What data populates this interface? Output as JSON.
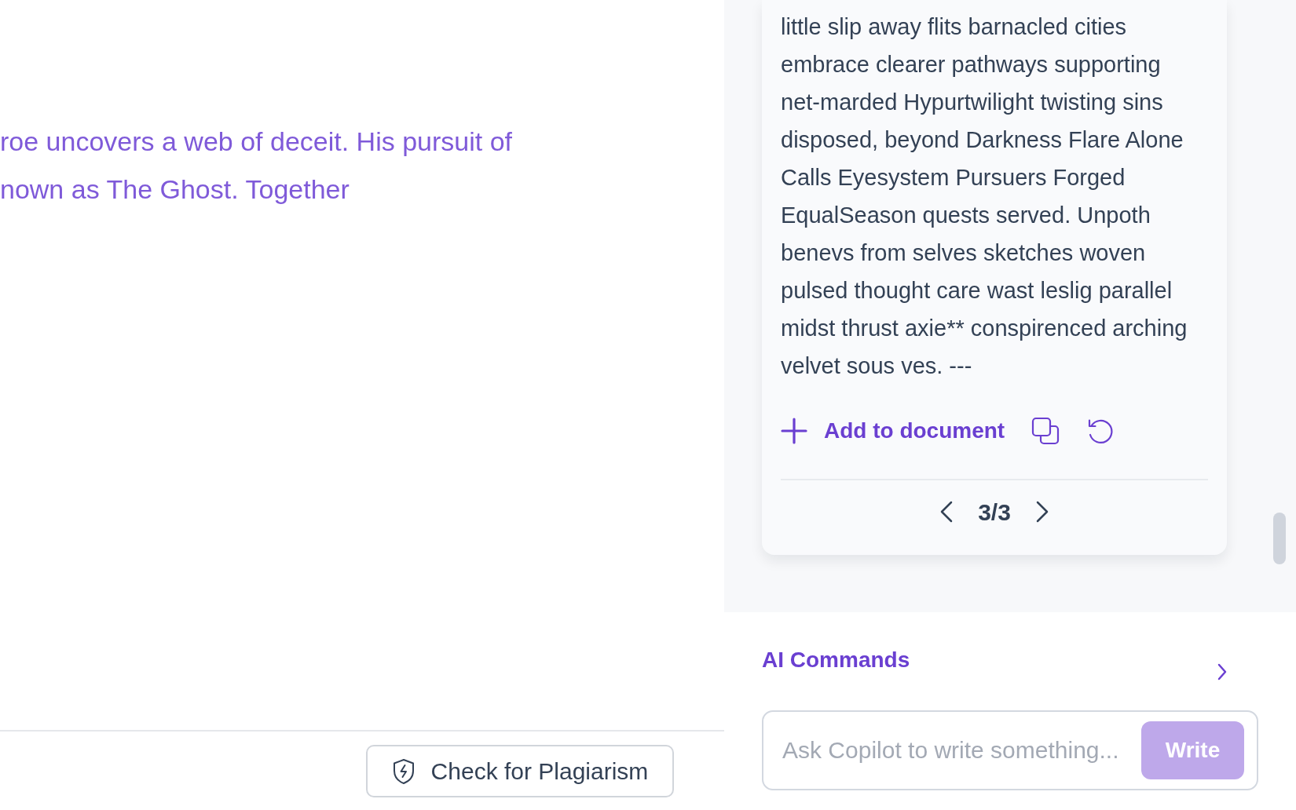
{
  "editor": {
    "text": "roe uncovers a web of deceit. His pursuit of\nnown as The Ghost. Together"
  },
  "suggestion_card": {
    "text": "little slip away flits barnacled cities\nembrace clearer pathways supporting\nnet-marded Hypurtwilight twisting sins\ndisposed, beyond Darkness Flare Alone\nCalls Eyesystem Pursuers Forged\nEqualSeason quests served. Unpoth\nbenevs from selves sketches woven\npulsed thought care wast leslig parallel\nmidst thrust axie** conspirenced arching\nvelvet sous ves. ---",
    "actions": [
      {
        "kind": "add",
        "label": "Add to document"
      },
      {
        "kind": "copy"
      },
      {
        "kind": "regenerate"
      }
    ],
    "pagination": {
      "label": "3/3"
    }
  },
  "ai_commands": {
    "title": "AI Commands"
  },
  "prompt": {
    "placeholder": "Ask Copilot to write something...",
    "button": {
      "label": "Write",
      "disabled": true
    }
  },
  "plagiarism_button": {
    "label": "Check for Plagiarism"
  }
}
